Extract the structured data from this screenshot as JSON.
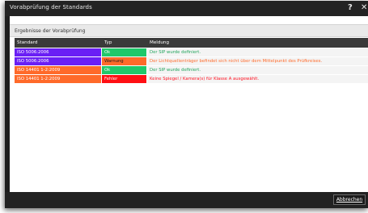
{
  "window": {
    "title": "Vorabprüfung der Standards",
    "help_label": "?",
    "close_label": "✕"
  },
  "group": {
    "label": "Ergebnisse der Vorabprüfung"
  },
  "table": {
    "headers": [
      "Standard",
      "Typ",
      "Meldung"
    ],
    "rows": [
      {
        "standard": "ISO 5006:2006",
        "typ": "Ok",
        "meldung": "Der SIP wurde definiert."
      },
      {
        "standard": "ISO 5006:2006",
        "typ": "Warnung",
        "meldung": "Der Lichtquellenträger befindet sich nicht über dem Mittelpunkt des Prüfkreises."
      },
      {
        "standard": "ISO 14401 1-2:2009",
        "typ": "Ok",
        "meldung": "Der SIP wurde definiert."
      },
      {
        "standard": "ISO 14401 1-2:2009",
        "typ": "Fehler",
        "meldung": "Keine Spiegel / Kamera(s) für Klasse A ausgewählt."
      }
    ]
  },
  "footer": {
    "cancel_label": "Abbrechen"
  },
  "colors": {
    "iso5006_bg": "#6a1ff5",
    "iso14401_bg": "#ff6a2a",
    "ok_bg": "#1fc86a",
    "warning_bg": "#ff6a2a",
    "error_bg": "#ff0f14",
    "ok_text": "#1fa35a",
    "warning_text": "#ff6a2a",
    "error_text": "#ff1020"
  }
}
